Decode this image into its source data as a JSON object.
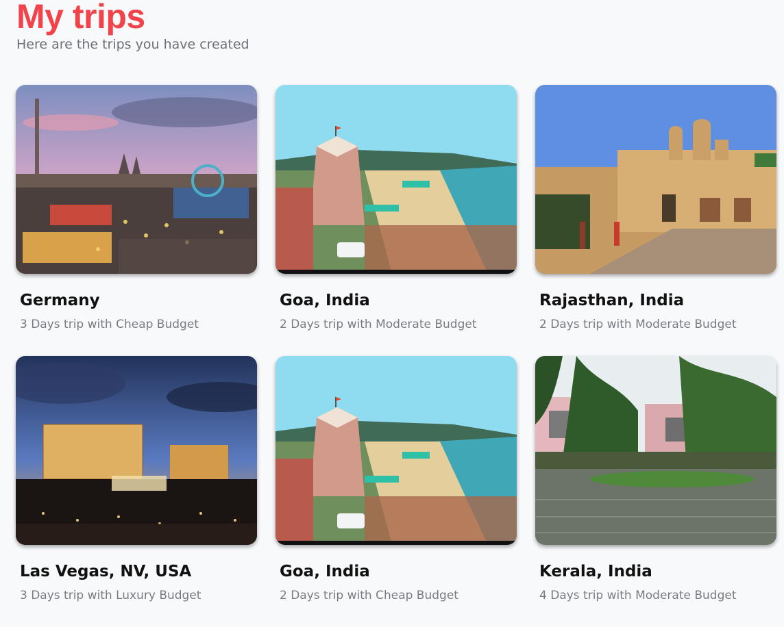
{
  "header": {
    "title": "My trips",
    "subtitle": "Here are the trips you have created"
  },
  "trips": [
    {
      "destination": "Germany",
      "summary": "3 Days trip with Cheap Budget",
      "scene": "festival"
    },
    {
      "destination": "Goa, India",
      "summary": "2 Days trip with Moderate Budget",
      "scene": "beach"
    },
    {
      "destination": "Rajasthan, India",
      "summary": "2 Days trip with Moderate Budget",
      "scene": "palace"
    },
    {
      "destination": "Las Vegas, NV, USA",
      "summary": "3 Days trip with Luxury Budget",
      "scene": "city-night"
    },
    {
      "destination": "Goa, India",
      "summary": "2 Days trip with Cheap Budget",
      "scene": "beach"
    },
    {
      "destination": "Kerala, India",
      "summary": "4 Days trip with Moderate Budget",
      "scene": "backwater"
    }
  ]
}
